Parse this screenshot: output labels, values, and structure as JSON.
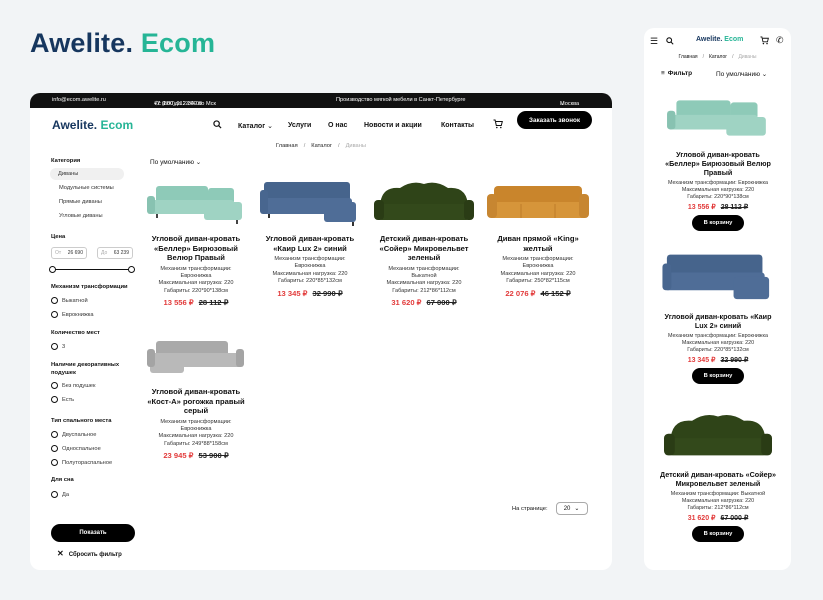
{
  "brand": {
    "part1": "Awelite.",
    "part2": " Ecom"
  },
  "topbar": {
    "email": "info@ecom.awelite.ru",
    "phone": "+7 (880) 012-34-00",
    "hours": "с 9:00 до 23:00 по Мск",
    "tagline": "Производство мягкой мебели в Санкт-Петербурге",
    "city": "Москва"
  },
  "nav": {
    "catalog": "Каталог",
    "services": "Услуги",
    "about": "О нас",
    "news": "Новости и акции",
    "contacts": "Контакты",
    "call_button": "Заказать звонок"
  },
  "breadcrumb": {
    "home": "Главная",
    "catalog": "Каталог",
    "current": "Диваны",
    "sep": "/"
  },
  "sort": {
    "label": "По умолчанию"
  },
  "filter": {
    "category_title": "Категория",
    "categories": [
      "Диваны",
      "Модульные системы",
      "Прямые диваны",
      "Угловые диваны"
    ],
    "price_title": "Цена",
    "price_from_label": "От",
    "price_from": "26 690",
    "price_to_label": "До",
    "price_to": "63 239",
    "mechanism_title": "Механизм трансформации",
    "mechanisms": [
      "Выкатной",
      "Еврокнижка"
    ],
    "seats_title": "Количество мест",
    "seats": [
      "3"
    ],
    "pillows_title": "Наличие декоративных подушек",
    "pillows": [
      "Без подушек",
      "Есть"
    ],
    "sleep_title": "Тип спального места",
    "sleep": [
      "Двуспальное",
      "Односпальное",
      "Полутораспальное"
    ],
    "forsleep_title": "Для сна",
    "forsleep": [
      "Да"
    ],
    "show_button": "Показать",
    "reset": "Сбросить фильтр"
  },
  "products": [
    {
      "title": "Угловой диван-кровать «Беллер» Бирюзовый Велюр Правый",
      "d1": "Механизм трансформации:",
      "d2": "Еврокнижка",
      "d3": "Максимальная нагрузка: 220",
      "d4": "Габариты: 220*90*138см",
      "price": "13 556 ₽",
      "old": "28 112 ₽",
      "color": "#9fd3c3"
    },
    {
      "title": "Угловой диван-кровать «Каир Lux 2» синий",
      "d1": "Механизм трансформации:",
      "d2": "Еврокнижка",
      "d3": "Максимальная нагрузка: 220",
      "d4": "Габариты: 220*85*132см",
      "price": "13 345 ₽",
      "old": "32 990 ₽",
      "color": "#4f6d97"
    },
    {
      "title": "Детский диван-кровать «Сойер» Микровельвет зеленый",
      "d1": "Механизм трансформации:",
      "d2": "Выкатной",
      "d3": "Максимальная нагрузка: 220",
      "d4": "Габариты: 212*86*112см",
      "price": "31 620 ₽",
      "old": "67 000 ₽",
      "color": "#2f4418"
    },
    {
      "title": "Диван прямой «King» желтый",
      "d1": "Механизм трансформации:",
      "d2": "Еврокнижка",
      "d3": "Максимальная нагрузка: 220",
      "d4": "Габариты: 250*82*115см",
      "price": "22 076 ₽",
      "old": "46 152 ₽",
      "color": "#d6953a"
    },
    {
      "title": "Угловой диван-кровать «Кост-А» рогожка правый серый",
      "d1": "Механизм трансформации:",
      "d2": "Еврокнижка",
      "d3": "Максимальная нагрузка: 220",
      "d4": "Габариты: 249*88*158см",
      "price": "23 945 ₽",
      "old": "53 900 ₽",
      "color": "#b9b9b9"
    }
  ],
  "pagination": {
    "per_page_label": "На странице:",
    "per_page": "20"
  },
  "mobile": {
    "filter": "Фильтр",
    "sort": "По умолчанию",
    "cart_button": "В корзину",
    "products": [
      {
        "title": "Угловой диван-кровать «Беллер» Бирюзовый Велюр Правый",
        "d1": "Механизм трансформации: Еврокнижка",
        "d2": "Максимальная нагрузка: 220",
        "d3": "Габариты: 220*90*138см",
        "price": "13 556 ₽",
        "old": "28 112 ₽"
      },
      {
        "title": "Угловой диван-кровать «Каир Lux 2» синий",
        "d1": "Механизм трансформации: Еврокнижка",
        "d2": "Максимальная нагрузка: 220",
        "d3": "Габариты: 220*85*132см",
        "price": "13 345 ₽",
        "old": "32 990 ₽"
      },
      {
        "title": "Детский диван-кровать «Сойер» Микровельвет зеленый",
        "d1": "Механизм трансформации: Выкатной",
        "d2": "Максимальная нагрузка: 220",
        "d3": "Габариты: 212*86*112см",
        "price": "31 620 ₽",
        "old": "67 000 ₽"
      }
    ]
  },
  "colors": {
    "brand_dark": "#16365e",
    "brand_green": "#26b596",
    "price_red": "#e23b3b"
  },
  "icons": {
    "search": "search-icon",
    "cart": "cart-icon",
    "phone": "phone-icon",
    "menu": "menu-icon",
    "filter": "filter-icon",
    "chevron": "chevron-down-icon",
    "close": "close-icon"
  }
}
